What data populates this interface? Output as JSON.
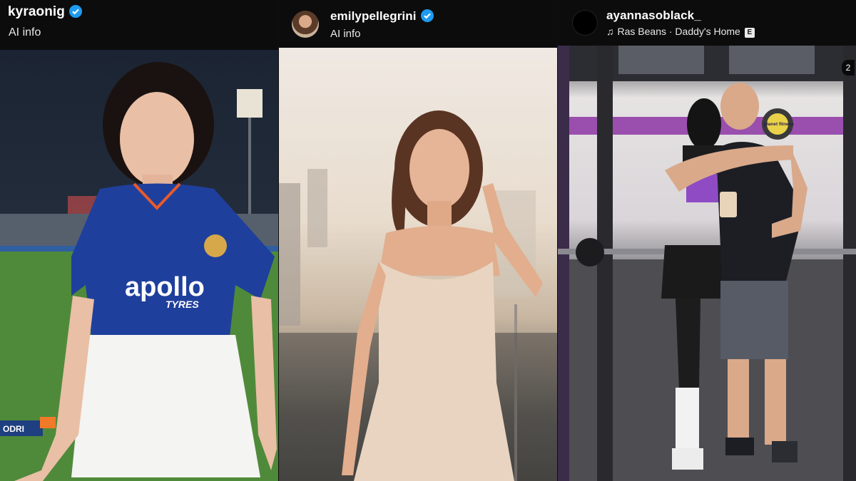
{
  "panels": [
    {
      "username": "kyraonig",
      "subtitle": "AI info",
      "verified": true
    },
    {
      "username": "emilypellegrini",
      "subtitle": "AI info",
      "verified": true
    },
    {
      "username": "ayannasoblack_",
      "music": "Ras Beans · Daddy's Home",
      "explicit_label": "E",
      "verified": false,
      "page_indicator": "2"
    }
  ],
  "photo_text": {
    "jersey_brand": "apollo",
    "jersey_sub": "TYRES",
    "gym_logo": "planet fitness",
    "board_left": "ODRI"
  },
  "colors": {
    "verified_badge": "#1d9bf0",
    "header_bg": "#0c0c0d"
  },
  "icons": [
    "verified-badge-icon",
    "music-note-icon",
    "explicit-badge-icon"
  ]
}
